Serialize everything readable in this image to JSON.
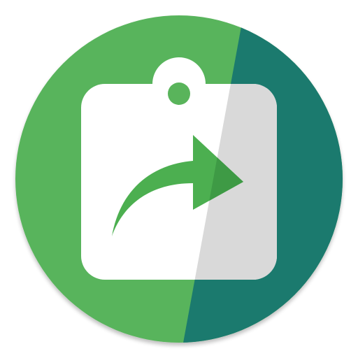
{
  "icon": {
    "name": "clipboard-share-icon",
    "colors": {
      "circle_left": "#59B45B",
      "circle_right": "#1B7A6E",
      "clipboard": "#FFFFFF",
      "clipboard_shadow_side": "#D9D9D9",
      "arrow": "#4CAF50",
      "arrow_shadow_side": "#3E9A45",
      "bottom_shadow": "#000000"
    }
  }
}
